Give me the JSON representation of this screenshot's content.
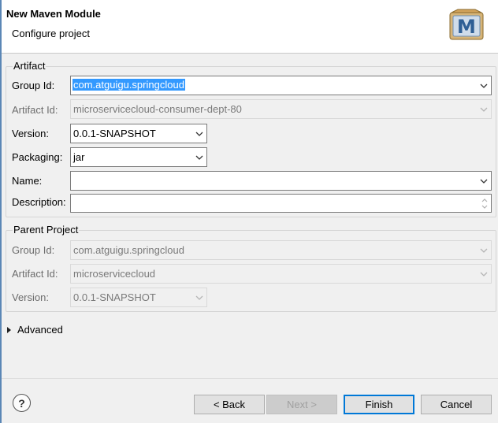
{
  "dialog": {
    "title": "New Maven Module",
    "subtitle": "Configure project",
    "logo_letter": "M"
  },
  "artifact": {
    "legend": "Artifact",
    "group_id": {
      "label": "Group Id:",
      "value": "com.atguigu.springcloud"
    },
    "artifact_id": {
      "label": "Artifact Id:",
      "value": "microservicecloud-consumer-dept-80"
    },
    "version": {
      "label": "Version:",
      "value": "0.0.1-SNAPSHOT"
    },
    "packaging": {
      "label": "Packaging:",
      "value": "jar"
    },
    "name": {
      "label": "Name:",
      "value": ""
    },
    "description": {
      "label": "Description:",
      "value": ""
    }
  },
  "parent": {
    "legend": "Parent Project",
    "group_id": {
      "label": "Group Id:",
      "value": "com.atguigu.springcloud"
    },
    "artifact_id": {
      "label": "Artifact Id:",
      "value": "microservicecloud"
    },
    "version": {
      "label": "Version:",
      "value": "0.0.1-SNAPSHOT"
    }
  },
  "advanced": {
    "label": "Advanced"
  },
  "buttons": {
    "help": "?",
    "back": "< Back",
    "next": "Next >",
    "finish": "Finish",
    "cancel": "Cancel"
  },
  "colors": {
    "selection": "#3399ff",
    "default_button_border": "#0078d7",
    "window_frame": "#5b87b6"
  }
}
